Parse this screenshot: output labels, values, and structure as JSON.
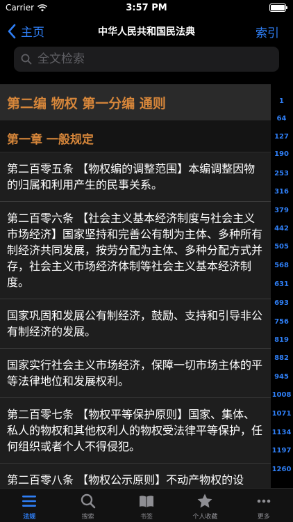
{
  "status_bar": {
    "carrier": "Carrier",
    "time": "3:57 PM"
  },
  "nav": {
    "back_label": "主页",
    "title": "中华人民共和国民法典",
    "right_label": "索引"
  },
  "search": {
    "placeholder": "全文检索"
  },
  "content": {
    "part_title": "第二编 物权 第一分编 通则",
    "chapter_title": "第一章 一般规定",
    "articles": [
      "第二百零五条 【物权编的调整范围】本编调整因物的归属和利用产生的民事关系。",
      "第二百零六条 【社会主义基本经济制度与社会主义市场经济】国家坚持和完善公有制为主体、多种所有制经济共同发展，按劳分配为主体、多种分配方式并存，社会主义市场经济体制等社会主义基本经济制度。",
      "国家巩固和发展公有制经济，鼓励、支持和引导非公有制经济的发展。",
      "国家实行社会主义市场经济，保障一切市场主体的平等法律地位和发展权利。",
      "第二百零七条 【物权平等保护原则】国家、集体、私人的物权和其他权利人的物权受法律平等保护，任何组织或者个人不得侵犯。",
      "第二百零八条 【物权公示原则】不动产物权的设立、变更、转让和消灭，应当依照法律规定登记。动产物权的设立和转让，应当依照法律规定交付。"
    ]
  },
  "index": [
    "1",
    "64",
    "127",
    "190",
    "253",
    "316",
    "379",
    "442",
    "505",
    "568",
    "631",
    "693",
    "756",
    "819",
    "882",
    "945",
    "1008",
    "1071",
    "1134",
    "1197",
    "1260"
  ],
  "tabs": [
    {
      "label": "法规",
      "icon": "list-icon"
    },
    {
      "label": "搜索",
      "icon": "search-icon"
    },
    {
      "label": "书签",
      "icon": "book-icon"
    },
    {
      "label": "个人收藏",
      "icon": "star-icon"
    },
    {
      "label": "更多",
      "icon": "more-icon"
    }
  ],
  "colors": {
    "accent": "#2f7ff6",
    "heading": "#d6863a"
  }
}
